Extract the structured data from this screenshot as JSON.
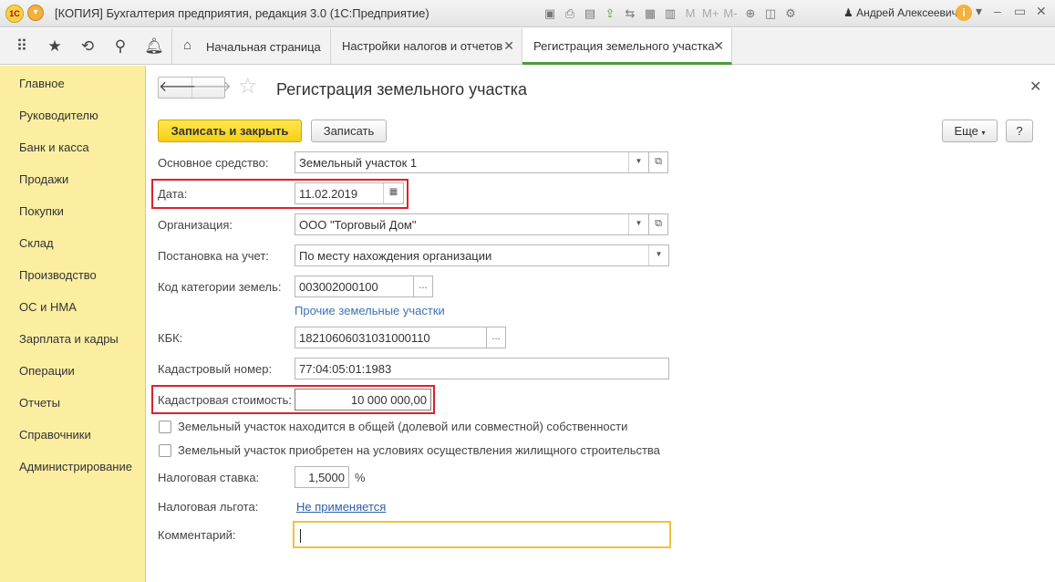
{
  "titlebar": {
    "logo": "1С",
    "title": "[КОПИЯ] Бухгалтерия предприятия, редакция 3.0  (1С:Предприятие)",
    "user": "Андрей Алексеевич",
    "info": "i",
    "icons": [
      "save-icon",
      "print-icon",
      "preview-icon",
      "upload-icon",
      "compare-icon",
      "calculator-icon",
      "calendar-icon",
      "memory-m-icon",
      "memory-plus-icon",
      "memory-minus-icon",
      "zoom-icon",
      "panel-icon",
      "tools-icon"
    ],
    "memory_labels": [
      "M",
      "M+",
      "M-"
    ]
  },
  "sectionbar": {
    "home_label": "Начальная страница",
    "tabs": [
      {
        "label": "Настройки налогов и отчетов"
      },
      {
        "label": "Регистрация земельного участка"
      }
    ]
  },
  "sidebar": {
    "items": [
      "Главное",
      "Руководителю",
      "Банк и касса",
      "Продажи",
      "Покупки",
      "Склад",
      "Производство",
      "ОС и НМА",
      "Зарплата и кадры",
      "Операции",
      "Отчеты",
      "Справочники",
      "Администрирование"
    ]
  },
  "form": {
    "title": "Регистрация земельного участка",
    "buttons": {
      "save_close": "Записать и закрыть",
      "save": "Записать",
      "more": "Еще",
      "help": "?"
    },
    "fields": {
      "asset": {
        "label": "Основное средство:",
        "value": "Земельный участок 1"
      },
      "date": {
        "label": "Дата:",
        "value": "11.02.2019"
      },
      "org": {
        "label": "Организация:",
        "value": "ООО \"Торговый Дом\""
      },
      "registration": {
        "label": "Постановка на учет:",
        "value": "По месту нахождения организации"
      },
      "land_category": {
        "label": "Код категории земель:",
        "value": "003002000100",
        "link": "Прочие земельные участки"
      },
      "kbk": {
        "label": "КБК:",
        "value": "18210606031031000110"
      },
      "cadastral_number": {
        "label": "Кадастровый номер:",
        "value": "77:04:05:01:1983"
      },
      "cadastral_value": {
        "label": "Кадастровая стоимость:",
        "value": "10 000 000,00"
      },
      "shared_ownership": {
        "label": "Земельный участок находится в общей (долевой или совместной) собственности",
        "checked": false
      },
      "housing": {
        "label": "Земельный участок приобретен на условиях осуществления жилищного строительства",
        "checked": false
      },
      "tax_rate": {
        "label": "Налоговая ставка:",
        "value": "1,5000",
        "unit": "%"
      },
      "tax_benefit": {
        "label": "Налоговая льгота:",
        "value": "Не применяется"
      },
      "comment": {
        "label": "Комментарий:",
        "value": ""
      }
    }
  }
}
